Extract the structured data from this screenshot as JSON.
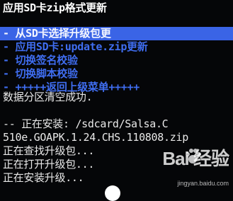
{
  "title": "应用SD卡zip格式更新",
  "menu": [
    {
      "label": "- 从SD卡选择升级包更",
      "selected": true
    },
    {
      "label": "- 应用SD卡:update.zip更新",
      "selected": false
    },
    {
      "label": "- 切换签名校验",
      "selected": false
    },
    {
      "label": "- 切换脚本校验",
      "selected": false
    },
    {
      "label": "- +++++返回上级菜单+++++",
      "selected": false
    }
  ],
  "log": [
    "数据分区清空成功.",
    "",
    "-- 正在安装: /sdcard/Salsa.C",
    "510e.GOAPK.1.24.CHS.110808.zip",
    "正在查找升级包...",
    "正在打开升级包...",
    "正在安装升级..."
  ],
  "watermark": {
    "brand": "Bai 经验",
    "url": "jingyan.baidu.com"
  }
}
